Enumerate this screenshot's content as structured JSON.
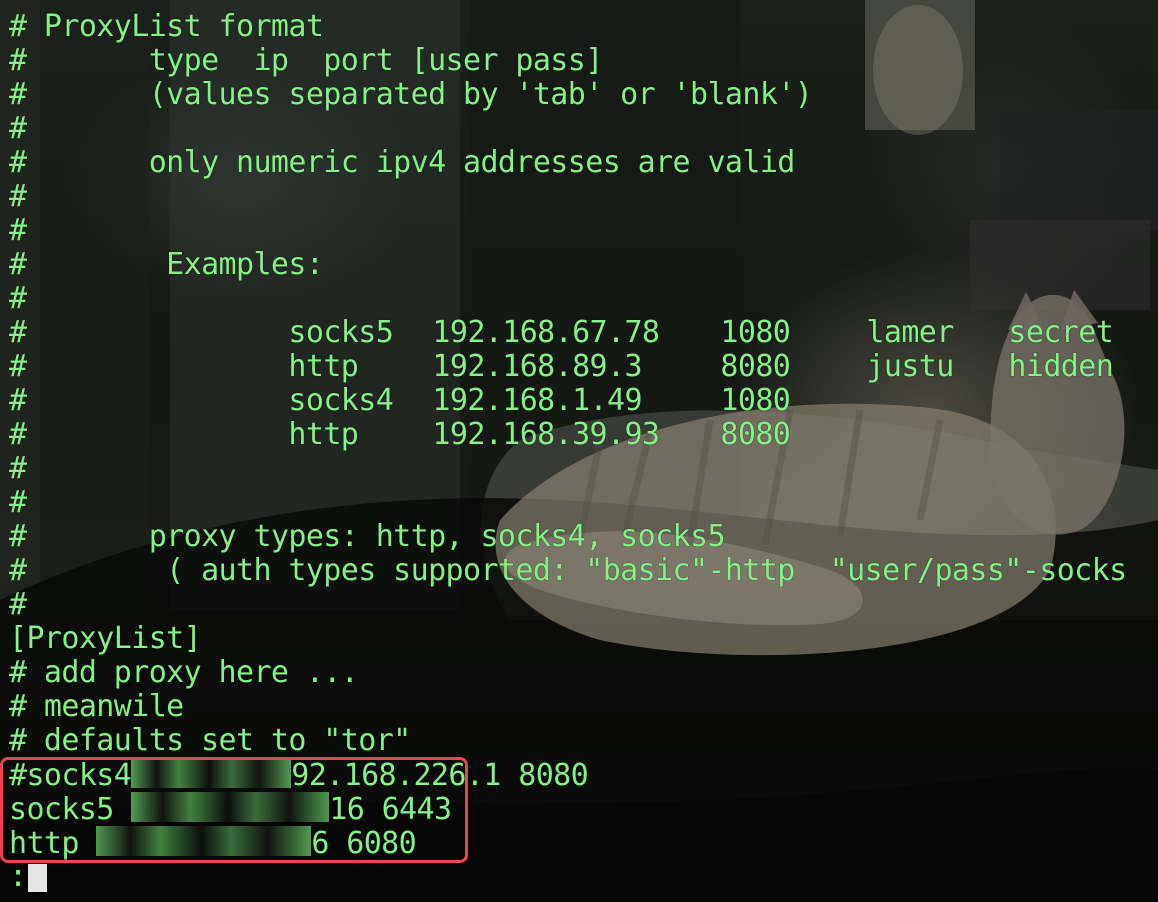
{
  "window": {
    "background_colors": {
      "text": "#84f284",
      "highlight": "#ea4550",
      "cursor": "#e6e6e6"
    }
  },
  "file": {
    "header": "# ProxyList format",
    "format_line": "#       type  ip  port [user pass]",
    "separator_line": "#       (values separated by 'tab' or 'blank')",
    "blank1": "#",
    "numeric_note": "#       only numeric ipv4 addresses are valid",
    "blank2": "#",
    "blank3": "#",
    "examples_title": "#        Examples:",
    "blank4": "#",
    "examples": [
      {
        "prefix": "#               ",
        "type": "socks5",
        "ip": "192.168.67.78",
        "port": "1080",
        "user": "lamer",
        "pass": "secret"
      },
      {
        "prefix": "#               ",
        "type": "http",
        "ip": "192.168.89.3",
        "port": "8080",
        "user": "justu",
        "pass": "hidden"
      },
      {
        "prefix": "#               ",
        "type": "socks4",
        "ip": "192.168.1.49",
        "port": "1080",
        "user": "",
        "pass": ""
      },
      {
        "prefix": "#               ",
        "type": "http",
        "ip": "192.168.39.93",
        "port": "8080",
        "user": "",
        "pass": ""
      }
    ],
    "blank5": "#",
    "blank6": "#",
    "proxy_types": "#       proxy types: http, socks4, socks5",
    "auth_types": "#        ( auth types supported: \"basic\"-http  \"user/pass\"-socks",
    "blank7": "#",
    "section": "[ProxyList]",
    "add_here": "# add proxy here ...",
    "meanwhile": "# meanwile",
    "defaults": "# defaults set to \"tor\"",
    "proxy_entries": [
      {
        "start": "#socks4",
        "masked": "",
        "end": "92.168.226.1 8080"
      },
      {
        "start": "socks5 ",
        "masked": "",
        "end": "16 6443"
      },
      {
        "start": "http ",
        "masked": "",
        "end": "6 6080"
      }
    ],
    "prompt": ":"
  }
}
